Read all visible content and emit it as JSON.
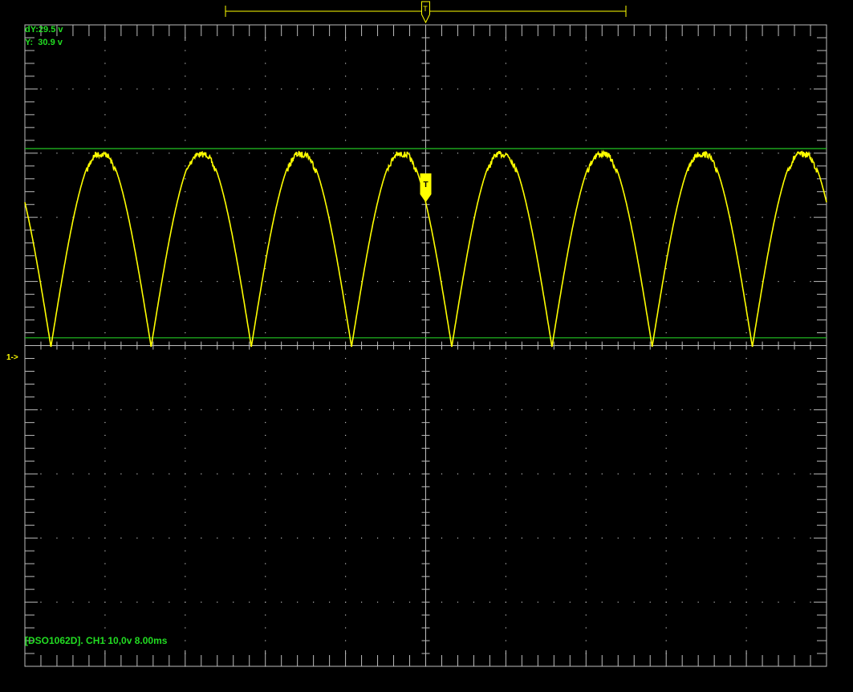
{
  "readouts": {
    "dY": "dY:29.5 v",
    "Y": "Y:  30.9 v"
  },
  "channel_marker": "1->",
  "trigger_label": "T",
  "status_line": "[DSO1062D]. CH1 10,0v 8.00ms",
  "colors": {
    "background": "#000000",
    "grid": "#bdbdbd",
    "trace": "#ffff00",
    "cursor": "#22c522",
    "readout_text": "#22dd22",
    "marker_text": "#ffff00"
  },
  "chart_data": {
    "type": "line",
    "grid_divisions": {
      "x": 10,
      "y": 10
    },
    "volts_per_div": 10.0,
    "time_per_div_ms": 8.0,
    "ground_level_v": 0,
    "waveform": {
      "name": "CH1",
      "shape": "full-wave rectified sine",
      "peak_v": 30.9,
      "period_ms": 10.0,
      "first_min_ms": 2.6,
      "time_range_ms": [
        0,
        80
      ]
    },
    "cursors": [
      {
        "axis": "y",
        "value_v": 30.9
      },
      {
        "axis": "y",
        "value_v": 1.4
      }
    ],
    "trigger_time_ms": 40.0
  }
}
